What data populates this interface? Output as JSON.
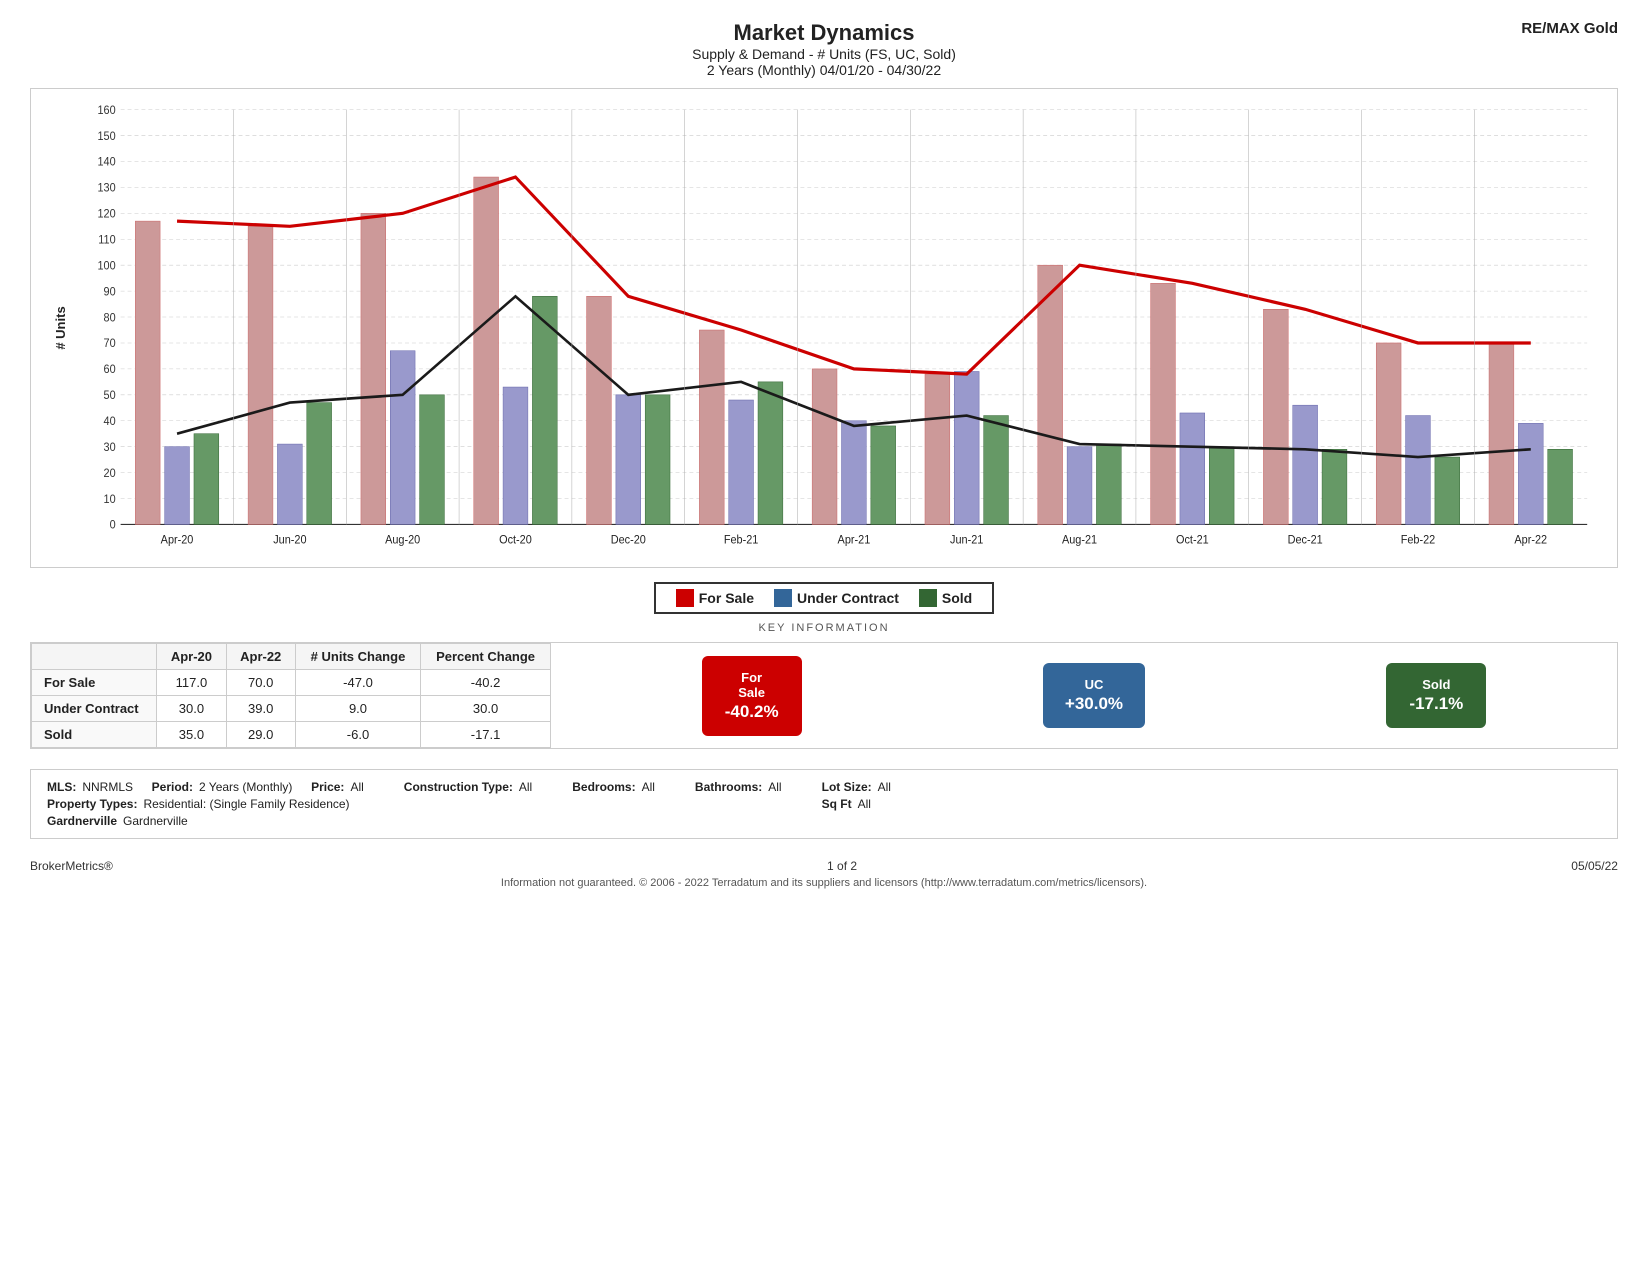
{
  "header": {
    "title": "Market Dynamics",
    "subtitle1": "Supply & Demand - # Units (FS, UC, Sold)",
    "subtitle2": "2 Years (Monthly) 04/01/20 - 04/30/22",
    "brand": "RE/MAX Gold"
  },
  "chart": {
    "y_label": "# Units",
    "y_max": 160,
    "y_ticks": [
      0,
      10,
      20,
      30,
      40,
      50,
      60,
      70,
      80,
      90,
      100,
      110,
      120,
      130,
      140,
      150,
      160
    ],
    "x_labels": [
      "Apr-20",
      "Jun-20",
      "Aug-20",
      "Oct-20",
      "Dec-20",
      "Feb-21",
      "Apr-21",
      "Jun-21",
      "Aug-21",
      "Oct-21",
      "Dec-21",
      "Feb-22",
      "Apr-22"
    ],
    "bars": [
      {
        "month": "Apr-20",
        "fs": 117,
        "uc": 30,
        "sold": 35
      },
      {
        "month": "Jun-20",
        "fs": 115,
        "uc": 31,
        "sold": 47
      },
      {
        "month": "Aug-20",
        "fs": 120,
        "uc": 67,
        "sold": 50
      },
      {
        "month": "Oct-20",
        "fs": 134,
        "uc": 53,
        "sold": 88
      },
      {
        "month": "Dec-20",
        "fs": 88,
        "uc": 50,
        "sold": 50
      },
      {
        "month": "Feb-21",
        "fs": 75,
        "uc": 48,
        "sold": 55
      },
      {
        "month": "Apr-21",
        "fs": 60,
        "uc": 40,
        "sold": 38
      },
      {
        "month": "Jun-21",
        "fs": 58,
        "uc": 59,
        "sold": 42
      },
      {
        "month": "Aug-21",
        "fs": 100,
        "uc": 30,
        "sold": 31
      },
      {
        "month": "Oct-21",
        "fs": 93,
        "uc": 43,
        "sold": 30
      },
      {
        "month": "Dec-21",
        "fs": 83,
        "uc": 46,
        "sold": 29
      },
      {
        "month": "Feb-22",
        "fs": 70,
        "uc": 42,
        "sold": 26
      },
      {
        "month": "Apr-22",
        "fs": 70,
        "uc": 39,
        "sold": 29
      }
    ],
    "trend_fs_start": 117,
    "trend_fs_end": 70,
    "trend_sold_value": 30
  },
  "legend": {
    "items": [
      {
        "label": "For Sale",
        "color": "#cc6666"
      },
      {
        "label": "Under Contract",
        "color": "#6699cc"
      },
      {
        "label": "Sold",
        "color": "#669966"
      }
    ]
  },
  "key_information": "KEY INFORMATION",
  "table": {
    "headers": [
      "",
      "Apr-20",
      "Apr-22",
      "# Units Change",
      "Percent Change"
    ],
    "rows": [
      {
        "label": "For Sale",
        "apr20": "117.0",
        "apr22": "70.0",
        "units_change": "-47.0",
        "pct_change": "-40.2"
      },
      {
        "label": "Under Contract",
        "apr20": "30.0",
        "apr22": "39.0",
        "units_change": "9.0",
        "pct_change": "30.0"
      },
      {
        "label": "Sold",
        "apr20": "35.0",
        "apr22": "29.0",
        "units_change": "-6.0",
        "pct_change": "-17.1"
      }
    ]
  },
  "cards": [
    {
      "label": "For Sale",
      "value": "-40.2%",
      "class": "card-for-sale"
    },
    {
      "label": "UC",
      "value": "+30.0%",
      "class": "card-uc"
    },
    {
      "label": "Sold",
      "value": "-17.1%",
      "class": "card-sold"
    }
  ],
  "meta": {
    "mls_label": "MLS:",
    "mls_value": "NNRMLS",
    "period_label": "Period:",
    "period_value": "2 Years (Monthly)",
    "price_label": "Price:",
    "price_value": "All",
    "construction_label": "Construction Type:",
    "construction_value": "All",
    "bedrooms_label": "Bedrooms:",
    "bedrooms_value": "All",
    "bathrooms_label": "Bathrooms:",
    "bathrooms_value": "All",
    "lot_size_label": "Lot Size:",
    "lot_size_value": "All",
    "sqft_label": "Sq Ft",
    "sqft_value": "All",
    "property_types_label": "Property Types:",
    "property_types_value": "Residential: (Single Family Residence)",
    "city_label": "Gardnerville",
    "city_value": "Gardnerville"
  },
  "footer": {
    "left": "BrokerMetrics®",
    "center": "1 of 2",
    "right": "05/05/22",
    "disclaimer": "Information not guaranteed. © 2006 - 2022 Terradatum and its suppliers and licensors (http://www.terradatum.com/metrics/licensors)."
  }
}
